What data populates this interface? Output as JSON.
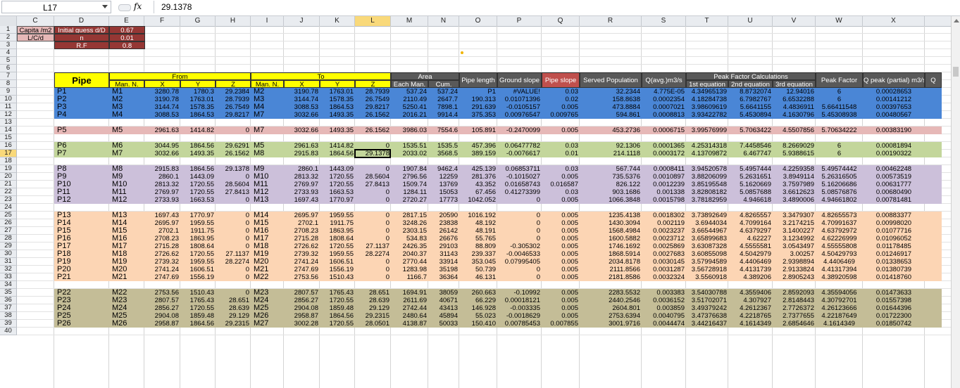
{
  "formula_bar": {
    "name_box": "L17",
    "fx": "fx",
    "value": "29.1378"
  },
  "columns": [
    "C",
    "D",
    "E",
    "F",
    "G",
    "H",
    "I",
    "J",
    "K",
    "L",
    "M",
    "N",
    "O",
    "P",
    "Q",
    "R",
    "S",
    "T",
    "U",
    "V",
    "W",
    "X"
  ],
  "selected_column": "L",
  "rows": [
    1,
    2,
    3,
    4,
    5,
    6,
    7,
    8,
    9,
    10,
    11,
    12,
    13,
    14,
    15,
    16,
    17,
    18,
    19,
    20,
    21,
    22,
    23,
    24,
    25,
    26,
    27,
    28,
    29,
    30,
    31,
    32,
    33,
    34,
    35,
    36,
    37,
    38,
    39,
    40
  ],
  "selected_row": 17,
  "params": [
    {
      "label": "Capita /m2",
      "name": "Initial guess d/D",
      "value": "0.67"
    },
    {
      "label": "L/C/d",
      "name": "n",
      "value": "0.01"
    },
    {
      "label": "",
      "name": "R.F",
      "value": "0.8"
    }
  ],
  "headers": {
    "pipe": "Pipe",
    "from": "From",
    "to": "To",
    "area": "Area",
    "peak_group": "Peak Factor Calculations",
    "man_n": "Man. N.",
    "x": "X",
    "y": "Y",
    "z": "Z",
    "each_man": "Each Man.",
    "cum": "Cum.",
    "pipe_length": "Pipe length",
    "ground_slope": "Ground slope",
    "pipe_slope": "Pipe slope",
    "served_pop": "Served Population",
    "q_avg": "Q(avg.)m3/s",
    "eq1": "1st equation",
    "eq2": "2nd equation",
    "eq3": "3rd equation",
    "peak_factor": "Peak Factor",
    "q_peak": "Q peak (partial) m3/s",
    "q_cut": "Q"
  },
  "colors": {
    "blue": "#4a86d6",
    "pink": "#e6b8b7",
    "green": "#c3d69b",
    "purple": "#ccc0da",
    "orange": "#fcd5b4",
    "olive": "#c4bd97",
    "yellow": "#ffff00",
    "dark": "#595959",
    "maroon": "#953734",
    "red": "#c0504d"
  },
  "table": [
    {
      "row": 9,
      "band": "blue",
      "p": "P1",
      "m1": "M1",
      "fx": "3280.78",
      "fy": "1780.3",
      "fz": "29.2384",
      "m2": "M2",
      "tx": "3190.78",
      "ty": "1763.01",
      "tz": "28.7939",
      "each": "537.24",
      "cum": "537.24",
      "len": "P1",
      "gs": "#VALUE!",
      "ps": "0.03",
      "pop": "32.2344",
      "q": "4.775E-05",
      "e1": "4.34965139",
      "e2": "8.8732074",
      "e3": "12.94016",
      "pf": "6",
      "qp": "0.00028653"
    },
    {
      "row": 10,
      "band": "blue",
      "p": "P2",
      "m1": "M2",
      "fx": "3190.78",
      "fy": "1763.01",
      "fz": "28.7939",
      "m2": "M3",
      "tx": "3144.74",
      "ty": "1578.35",
      "tz": "26.7549",
      "each": "2110.49",
      "cum": "2647.7",
      "len": "190.313",
      "gs": "0.01071396",
      "ps": "0.02",
      "pop": "158.8638",
      "q": "0.0002354",
      "e1": "4.18284738",
      "e2": "6.7982767",
      "e3": "6.6532288",
      "pf": "6",
      "qp": "0.00141212"
    },
    {
      "row": 11,
      "band": "blue",
      "p": "P3",
      "m1": "M3",
      "fx": "3144.74",
      "fy": "1578.35",
      "fz": "26.7549",
      "m2": "M4",
      "tx": "3088.53",
      "ty": "1864.53",
      "tz": "29.8217",
      "each": "5250.41",
      "cum": "7898.1",
      "len": "291.639",
      "gs": "-0.0105157",
      "ps": "0.005",
      "pop": "473.8884",
      "q": "0.0007021",
      "e1": "3.98609619",
      "e2": "5.6641155",
      "e3": "4.4836911",
      "pf": "5.66411548",
      "qp": "0.00397653"
    },
    {
      "row": 12,
      "band": "blue",
      "p": "P4",
      "m1": "M4",
      "fx": "3088.53",
      "fy": "1864.53",
      "fz": "29.8217",
      "m2": "M7",
      "tx": "3032.66",
      "ty": "1493.35",
      "tz": "26.1562",
      "each": "2016.21",
      "cum": "9914.4",
      "len": "375.353",
      "gs": "0.00976547",
      "ps": "0.009765",
      "pop": "594.861",
      "q": "0.0008813",
      "e1": "3.93422782",
      "e2": "5.4530894",
      "e3": "4.1630796",
      "pf": "5.45308938",
      "qp": "0.00480567"
    },
    {
      "row": 14,
      "band": "pink",
      "p": "P5",
      "m1": "M5",
      "fx": "2961.63",
      "fy": "1414.82",
      "fz": "0",
      "m2": "M7",
      "tx": "3032.66",
      "ty": "1493.35",
      "tz": "26.1562",
      "each": "3986.03",
      "cum": "7554.6",
      "len": "105.891",
      "gs": "-0.2470099",
      "ps": "0.005",
      "pop": "453.2736",
      "q": "0.0006715",
      "e1": "3.99576999",
      "e2": "5.7063422",
      "e3": "4.5507856",
      "pf": "5.70634222",
      "qp": "0.00383190"
    },
    {
      "row": 16,
      "band": "green",
      "p": "P6",
      "m1": "M6",
      "fx": "3044.95",
      "fy": "1864.56",
      "fz": "29.6291",
      "m2": "M5",
      "tx": "2961.63",
      "ty": "1414.82",
      "tz": "0",
      "each": "1535.51",
      "cum": "1535.5",
      "len": "457.396",
      "gs": "0.06477782",
      "ps": "0.03",
      "pop": "92.1306",
      "q": "0.0001365",
      "e1": "4.25314318",
      "e2": "7.4458546",
      "e3": "8.2669029",
      "pf": "6",
      "qp": "0.00081894"
    },
    {
      "row": 17,
      "band": "green",
      "p": "P7",
      "m1": "M7",
      "fx": "3032.66",
      "fy": "1493.35",
      "fz": "26.1562",
      "m2": "M8",
      "tx": "2915.83",
      "ty": "1864.56",
      "tz": "29.1378",
      "each": "2033.02",
      "cum": "3568.5",
      "len": "389.159",
      "gs": "-0.0076617",
      "ps": "0.01",
      "pop": "214.1118",
      "q": "0.0003172",
      "e1": "4.13709872",
      "e2": "6.467747",
      "e3": "5.9388615",
      "pf": "6",
      "qp": "0.00190322"
    },
    {
      "row": 19,
      "band": "purple",
      "p": "P8",
      "m1": "M8",
      "fx": "2915.83",
      "fy": "1864.56",
      "fz": "29.1378",
      "m2": "M9",
      "tx": "2860.1",
      "ty": "1443.09",
      "tz": "0",
      "each": "1907.84",
      "cum": "9462.4",
      "len": "425.139",
      "gs": "0.06853711",
      "ps": "0.03",
      "pop": "567.744",
      "q": "0.0008411",
      "e1": "3.94520578",
      "e2": "5.4957444",
      "e3": "4.2259358",
      "pf": "5.49574442",
      "qp": "0.00462248"
    },
    {
      "row": 20,
      "band": "purple",
      "p": "P9",
      "m1": "M9",
      "fx": "2860.1",
      "fy": "1443.09",
      "fz": "0",
      "m2": "M10",
      "tx": "2813.32",
      "ty": "1720.55",
      "tz": "28.5604",
      "each": "2796.56",
      "cum": "12259",
      "len": "281.376",
      "gs": "-0.1015027",
      "ps": "0.005",
      "pop": "735.5376",
      "q": "0.0010897",
      "e1": "3.88206099",
      "e2": "5.2631651",
      "e3": "3.8949114",
      "pf": "5.26316505",
      "qp": "0.00573519"
    },
    {
      "row": 21,
      "band": "purple",
      "p": "P10",
      "m1": "M10",
      "fx": "2813.32",
      "fy": "1720.55",
      "fz": "28.5604",
      "m2": "M11",
      "tx": "2769.97",
      "ty": "1720.55",
      "tz": "27.8413",
      "each": "1509.74",
      "cum": "13769",
      "len": "43.352",
      "gs": "0.01658743",
      "ps": "0.016587",
      "pop": "826.122",
      "q": "0.0012239",
      "e1": "3.85195548",
      "e2": "5.1620669",
      "e3": "3.7597989",
      "pf": "5.16206686",
      "qp": "0.00631777"
    },
    {
      "row": 22,
      "band": "purple",
      "p": "P11",
      "m1": "M11",
      "fx": "2769.97",
      "fy": "1720.55",
      "fz": "27.8413",
      "m2": "M12",
      "tx": "2733.93",
      "ty": "1663.53",
      "tz": "0",
      "each": "1284.11",
      "cum": "15053",
      "len": "67.456",
      "gs": "0.41273399",
      "ps": "0.03",
      "pop": "903.1686",
      "q": "0.001338",
      "e1": "3.82808182",
      "e2": "5.0857688",
      "e3": "3.6612623",
      "pf": "5.08576876",
      "qp": "0.00680490"
    },
    {
      "row": 23,
      "band": "purple",
      "p": "P12",
      "m1": "M12",
      "fx": "2733.93",
      "fy": "1663.53",
      "fz": "0",
      "m2": "M13",
      "tx": "1697.43",
      "ty": "1770.97",
      "tz": "0",
      "each": "2720.27",
      "cum": "17773",
      "len": "1042.052",
      "gs": "0",
      "ps": "0.005",
      "pop": "1066.3848",
      "q": "0.0015798",
      "e1": "3.78182959",
      "e2": "4.946618",
      "e3": "3.4890006",
      "pf": "4.94661802",
      "qp": "0.00781481"
    },
    {
      "row": 25,
      "band": "orange",
      "p": "P13",
      "m1": "M13",
      "fx": "1697.43",
      "fy": "1770.97",
      "fz": "0",
      "m2": "M14",
      "tx": "2695.97",
      "ty": "1959.55",
      "tz": "0",
      "each": "2817.15",
      "cum": "20590",
      "len": "1016.192",
      "gs": "0",
      "ps": "0.005",
      "pop": "1235.4138",
      "q": "0.0018302",
      "e1": "3.73892649",
      "e2": "4.8265557",
      "e3": "3.3479307",
      "pf": "4.82655573",
      "qp": "0.00883377"
    },
    {
      "row": 26,
      "band": "orange",
      "p": "P14",
      "m1": "M14",
      "fx": "2695.97",
      "fy": "1959.55",
      "fz": "0",
      "m2": "M15",
      "tx": "2702.1",
      "ty": "1911.75",
      "tz": "0",
      "each": "3248.26",
      "cum": "23838",
      "len": "48.192",
      "gs": "0",
      "ps": "0.005",
      "pop": "1430.3094",
      "q": "0.002119",
      "e1": "3.6944034",
      "e2": "4.7099164",
      "e3": "3.2174215",
      "pf": "4.70991637",
      "qp": "0.00998020"
    },
    {
      "row": 27,
      "band": "orange",
      "p": "P15",
      "m1": "M15",
      "fx": "2702.1",
      "fy": "1911.75",
      "fz": "0",
      "m2": "M16",
      "tx": "2708.23",
      "ty": "1863.95",
      "tz": "0",
      "each": "2303.15",
      "cum": "26142",
      "len": "48.191",
      "gs": "0",
      "ps": "0.005",
      "pop": "1568.4984",
      "q": "0.0023237",
      "e1": "3.66544967",
      "e2": "4.6379297",
      "e3": "3.1400227",
      "pf": "4.63792972",
      "qp": "0.01077716"
    },
    {
      "row": 28,
      "band": "orange",
      "p": "P16",
      "m1": "M16",
      "fx": "2708.23",
      "fy": "1863.95",
      "fz": "0",
      "m2": "M17",
      "tx": "2715.28",
      "ty": "1808.64",
      "tz": "0",
      "each": "534.83",
      "cum": "26676",
      "len": "55.765",
      "gs": "0",
      "ps": "0.005",
      "pop": "1600.5882",
      "q": "0.0023712",
      "e1": "3.65899683",
      "e2": "4.62227",
      "e3": "3.1234992",
      "pf": "4.62226999",
      "qp": "0.01096052"
    },
    {
      "row": 29,
      "band": "orange",
      "p": "P17",
      "m1": "M17",
      "fx": "2715.28",
      "fy": "1808.64",
      "fz": "0",
      "m2": "M18",
      "tx": "2726.62",
      "ty": "1720.55",
      "tz": "27.1137",
      "each": "2426.35",
      "cum": "29103",
      "len": "88.809",
      "gs": "-0.305302",
      "ps": "0.005",
      "pop": "1746.1692",
      "q": "0.0025869",
      "e1": "3.63087328",
      "e2": "4.5555581",
      "e3": "3.0543497",
      "pf": "4.55555808",
      "qp": "0.01178485"
    },
    {
      "row": 30,
      "band": "orange",
      "p": "P18",
      "m1": "M18",
      "fx": "2726.62",
      "fy": "1720.55",
      "fz": "27.1137",
      "m2": "M19",
      "tx": "2739.32",
      "ty": "1959.55",
      "tz": "28.2274",
      "each": "2040.37",
      "cum": "31143",
      "len": "239.337",
      "gs": "-0.0046533",
      "ps": "0.005",
      "pop": "1868.5914",
      "q": "0.0027683",
      "e1": "3.60855098",
      "e2": "4.5042979",
      "e3": "3.00257",
      "pf": "4.50429793",
      "qp": "0.01246917"
    },
    {
      "row": 31,
      "band": "orange",
      "p": "P19",
      "m1": "M19",
      "fx": "2739.32",
      "fy": "1959.55",
      "fz": "28.2274",
      "m2": "M20",
      "tx": "2741.24",
      "ty": "1606.51",
      "tz": "0",
      "each": "2770.44",
      "cum": "33914",
      "len": "353.045",
      "gs": "0.07995405",
      "ps": "0.005",
      "pop": "2034.8178",
      "q": "0.0030145",
      "e1": "3.57994589",
      "e2": "4.4406469",
      "e3": "2.9398894",
      "pf": "4.4406469",
      "qp": "0.01338653"
    },
    {
      "row": 32,
      "band": "orange",
      "p": "P20",
      "m1": "M20",
      "fx": "2741.24",
      "fy": "1606.51",
      "fz": "0",
      "m2": "M21",
      "tx": "2747.69",
      "ty": "1556.19",
      "tz": "0",
      "each": "1283.98",
      "cum": "35198",
      "len": "50.739",
      "gs": "0",
      "ps": "0.005",
      "pop": "2111.8566",
      "q": "0.0031287",
      "e1": "3.56728918",
      "e2": "4.4131739",
      "e3": "2.9133824",
      "pf": "4.41317394",
      "qp": "0.01380739"
    },
    {
      "row": 33,
      "band": "orange",
      "p": "P21",
      "m1": "M21",
      "fx": "2747.69",
      "fy": "1556.19",
      "fz": "0",
      "m2": "M22",
      "tx": "2753.56",
      "ty": "1510.43",
      "tz": "0",
      "each": "1166.7",
      "cum": "36364",
      "len": "46.131",
      "gs": "0",
      "ps": "0.005",
      "pop": "2181.8586",
      "q": "0.0032324",
      "e1": "3.5560918",
      "e2": "4.389206",
      "e3": "2.8905243",
      "pf": "4.38920598",
      "qp": "0.01418760"
    },
    {
      "row": 35,
      "band": "olive",
      "p": "P22",
      "m1": "M22",
      "fx": "2753.56",
      "fy": "1510.43",
      "fz": "0",
      "m2": "M23",
      "tx": "2807.57",
      "ty": "1765.43",
      "tz": "28.651",
      "each": "1694.91",
      "cum": "38059",
      "len": "260.663",
      "gs": "-0.10992",
      "ps": "0.005",
      "pop": "2283.5532",
      "q": "0.003383",
      "e1": "3.54030788",
      "e2": "4.3559406",
      "e3": "2.8592093",
      "pf": "4.35594056",
      "qp": "0.01473633"
    },
    {
      "row": 36,
      "band": "olive",
      "p": "P23",
      "m1": "M23",
      "fx": "2807.57",
      "fy": "1765.43",
      "fz": "28.651",
      "m2": "M24",
      "tx": "2856.27",
      "ty": "1720.55",
      "tz": "28.639",
      "each": "2611.69",
      "cum": "40671",
      "len": "66.229",
      "gs": "0.00018121",
      "ps": "0.005",
      "pop": "2440.2546",
      "q": "0.0036152",
      "e1": "3.51702071",
      "e2": "4.307927",
      "e3": "2.8148443",
      "pf": "4.30792701",
      "qp": "0.01557398"
    },
    {
      "row": 37,
      "band": "olive",
      "p": "P24",
      "m1": "M24",
      "fx": "2856.27",
      "fy": "1720.55",
      "fz": "28.639",
      "m2": "M25",
      "tx": "2904.08",
      "ty": "1859.48",
      "tz": "29.129",
      "each": "2742.44",
      "cum": "43413",
      "len": "146.928",
      "gs": "-0.003335",
      "ps": "0.005",
      "pop": "2604.801",
      "q": "0.003859",
      "e1": "3.49379242",
      "e2": "4.2612367",
      "e3": "2.7726372",
      "pf": "4.26123666",
      "qp": "0.01644396"
    },
    {
      "row": 38,
      "band": "olive",
      "p": "P25",
      "m1": "M25",
      "fx": "2904.08",
      "fy": "1859.48",
      "fz": "29.129",
      "m2": "M26",
      "tx": "2958.87",
      "ty": "1864.56",
      "tz": "29.2315",
      "each": "2480.64",
      "cum": "45894",
      "len": "55.023",
      "gs": "-0.0018629",
      "ps": "0.005",
      "pop": "2753.6394",
      "q": "0.0040795",
      "e1": "3.47376638",
      "e2": "4.2218765",
      "e3": "2.7377655",
      "pf": "4.22187649",
      "qp": "0.01722300"
    },
    {
      "row": 39,
      "band": "olive",
      "p": "P26",
      "m1": "M26",
      "fx": "2958.87",
      "fy": "1864.56",
      "fz": "29.2315",
      "m2": "M27",
      "tx": "3002.28",
      "ty": "1720.55",
      "tz": "28.0501",
      "each": "4138.87",
      "cum": "50033",
      "len": "150.410",
      "gs": "0.00785453",
      "ps": "0.007855",
      "pop": "3001.9716",
      "q": "0.0044474",
      "e1": "3.44216437",
      "e2": "4.1614349",
      "e3": "2.6854646",
      "pf": "4.1614349",
      "qp": "0.01850742"
    }
  ]
}
